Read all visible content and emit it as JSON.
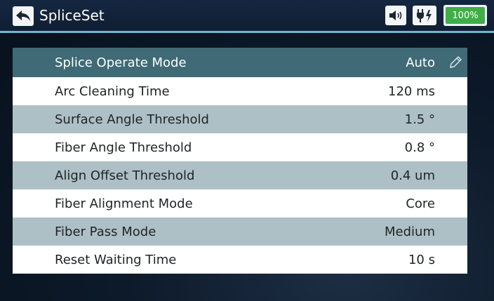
{
  "header": {
    "title": "SpliceSet",
    "back_icon": "back-arrow-icon",
    "sound_icon": "speaker-icon",
    "power_icon": "plug-power-icon",
    "battery_label": "100%",
    "battery_color": "#3fae46",
    "accent_color": "#6fb6d2"
  },
  "settings": {
    "rows": [
      {
        "label": "Splice Operate Mode",
        "value": "Auto"
      },
      {
        "label": "Arc Cleaning Time",
        "value": "120 ms"
      },
      {
        "label": "Surface Angle Threshold",
        "value": "1.5 °"
      },
      {
        "label": "Fiber Angle Threshold",
        "value": "0.8 °"
      },
      {
        "label": "Align Offset Threshold",
        "value": "0.4 um"
      },
      {
        "label": "Fiber Alignment Mode",
        "value": "Core"
      },
      {
        "label": "Fiber Pass Mode",
        "value": "Medium"
      },
      {
        "label": "Reset Waiting Time",
        "value": "10 s"
      }
    ],
    "selected_row_color": "#3f6a76",
    "edit_icon": "pencil-icon"
  }
}
